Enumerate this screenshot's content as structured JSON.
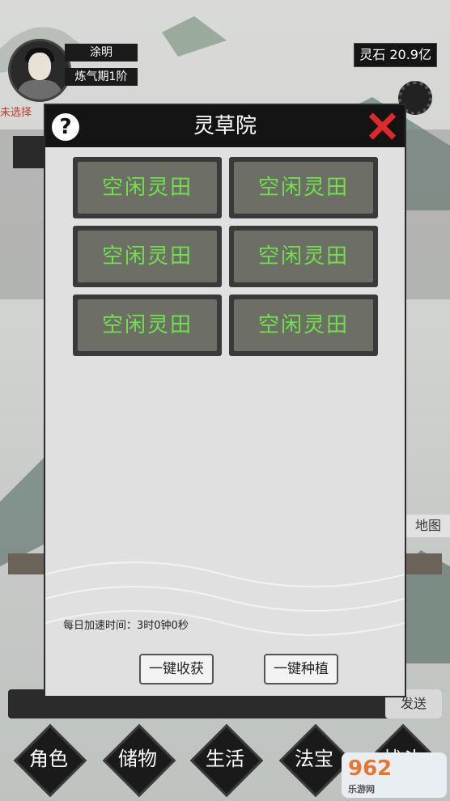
{
  "player": {
    "name": "涂明",
    "level": "炼气期1阶",
    "status_text": "未选择"
  },
  "currency": {
    "label": "灵石",
    "value": "20.9亿"
  },
  "background": {
    "map_label": "地图",
    "send_label": "发送"
  },
  "modal": {
    "title": "灵草院",
    "help_symbol": "?",
    "plots": [
      {
        "label": "空闲灵田"
      },
      {
        "label": "空闲灵田"
      },
      {
        "label": "空闲灵田"
      },
      {
        "label": "空闲灵田"
      },
      {
        "label": "空闲灵田"
      },
      {
        "label": "空闲灵田"
      }
    ],
    "speed_text": "每日加速时间：3时0钟0秒",
    "harvest_all_label": "一键收获",
    "plant_all_label": "一键种植"
  },
  "nav": {
    "items": [
      {
        "label": "角色"
      },
      {
        "label": "储物"
      },
      {
        "label": "生活"
      },
      {
        "label": "法宝"
      },
      {
        "label": "战斗"
      }
    ]
  },
  "watermark": {
    "text": "962",
    "sub": "乐游网"
  },
  "colors": {
    "plot_text": "#6ee24a",
    "close_icon": "#e02a2a",
    "status_text": "#c0392b"
  }
}
